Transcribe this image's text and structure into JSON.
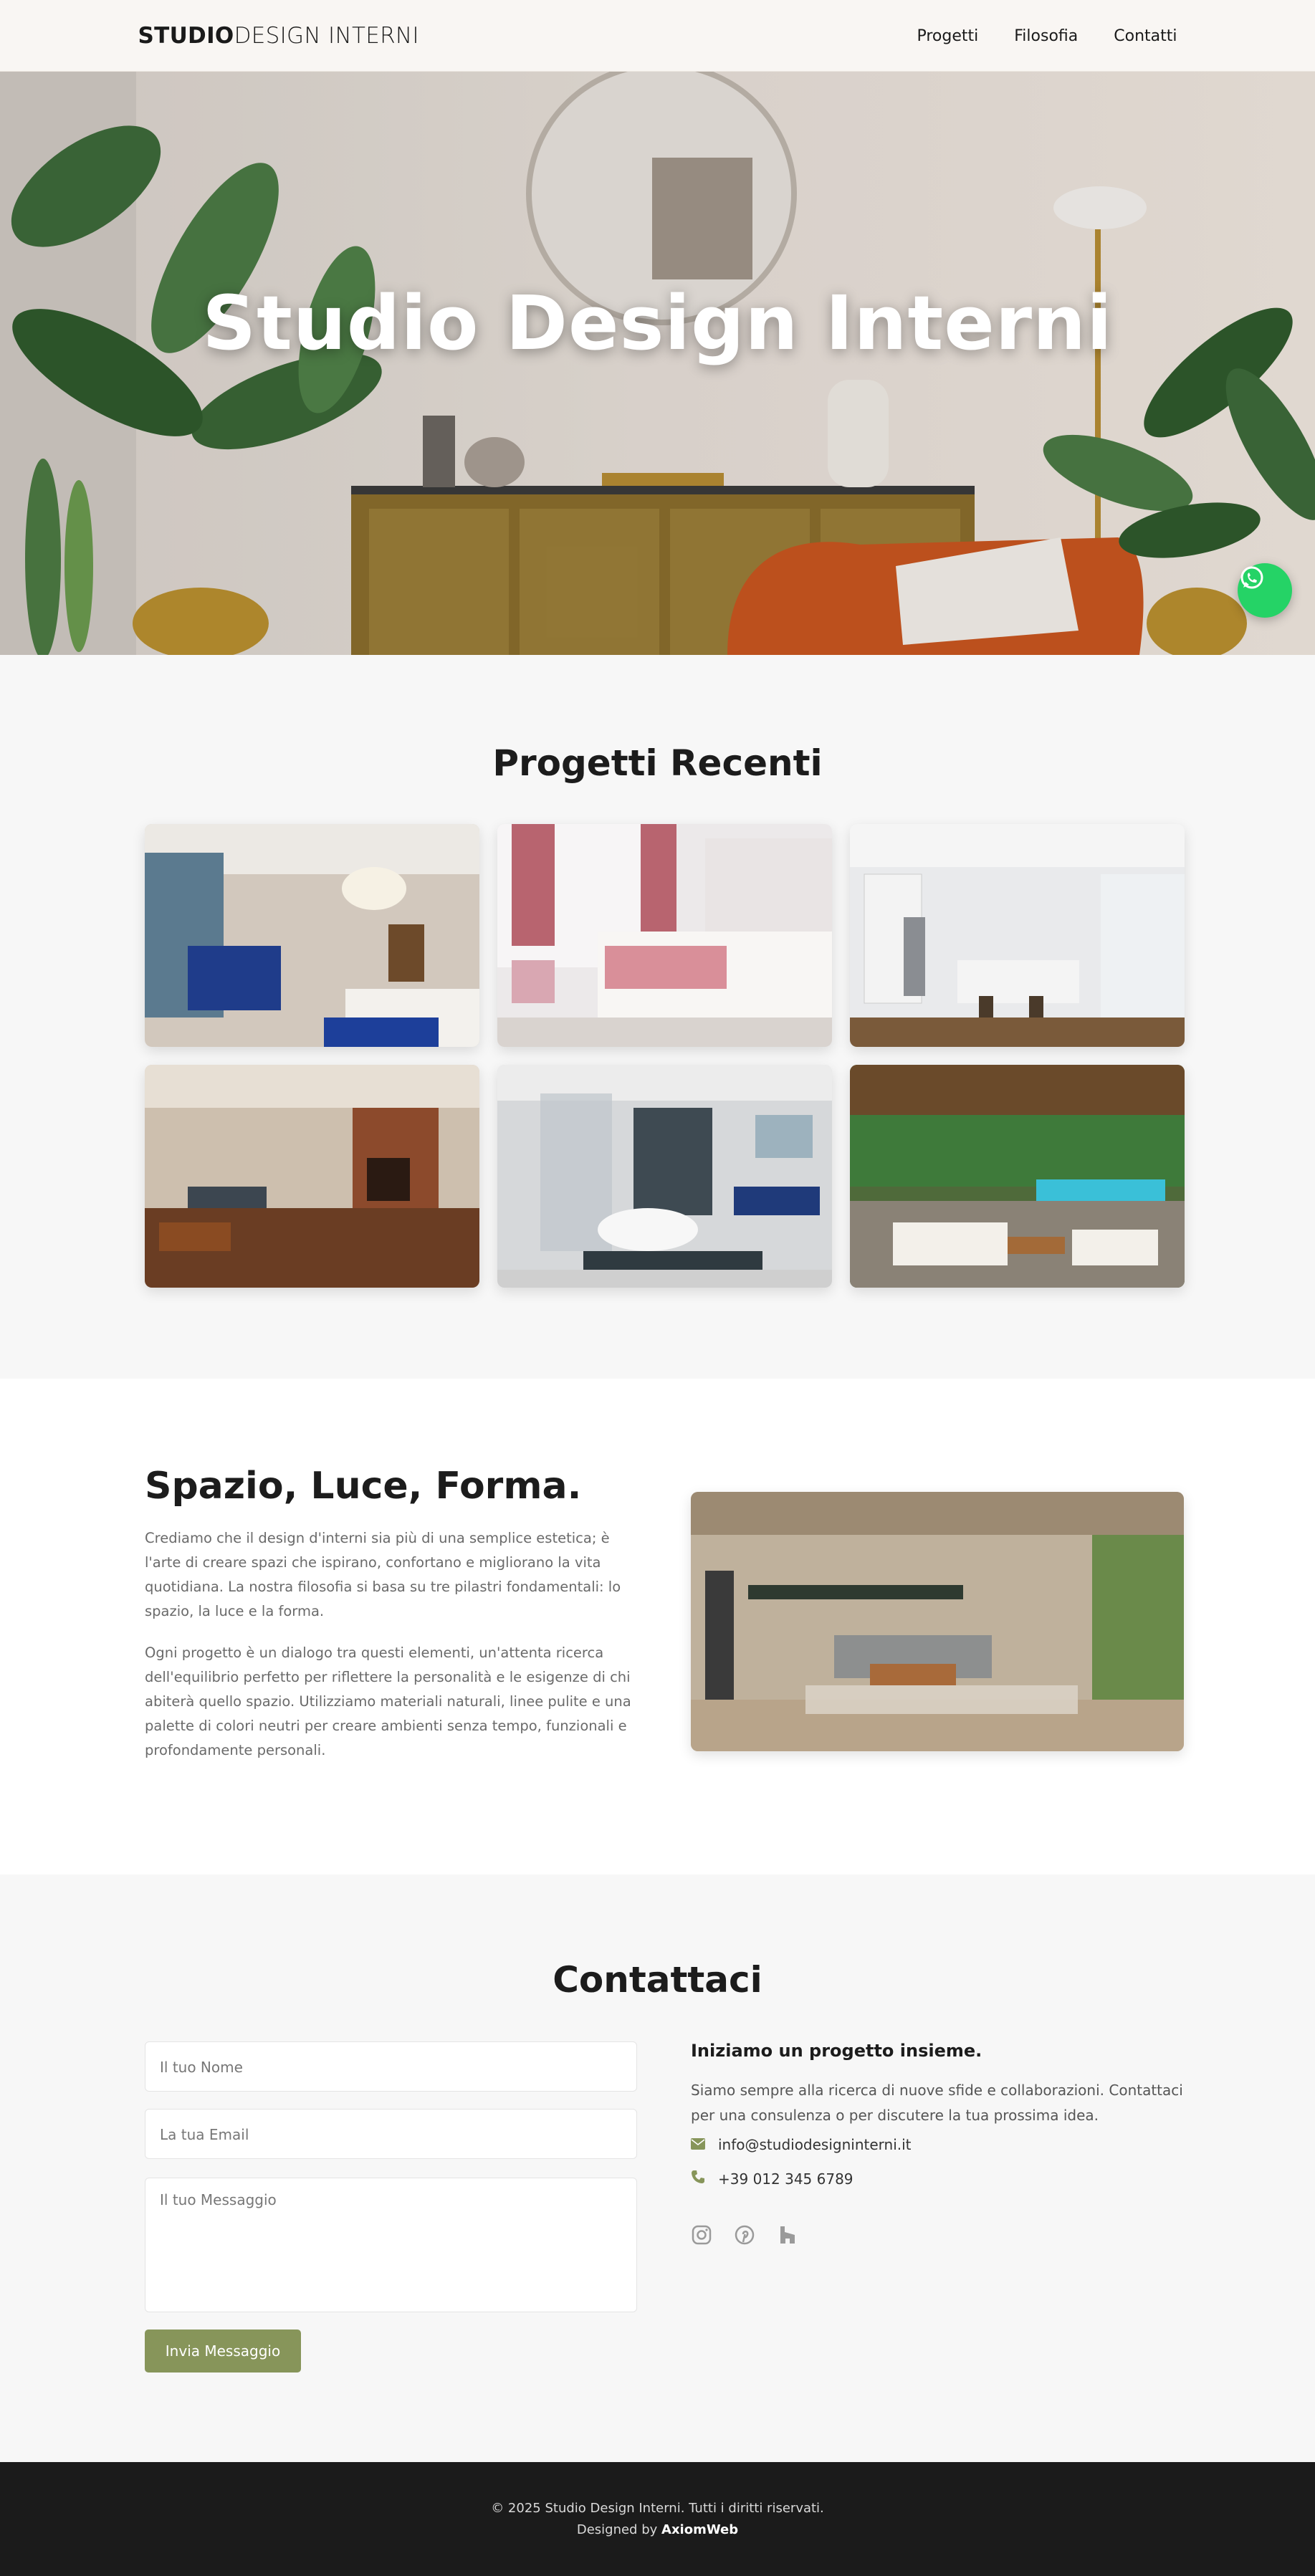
{
  "header": {
    "logo_bold": "STUDIO",
    "logo_light": "DESIGN INTERNI",
    "nav": [
      "Progetti",
      "Filosofia",
      "Contatti"
    ]
  },
  "hero": {
    "title": "Studio Design Interni"
  },
  "projects": {
    "title": "Progetti Recenti",
    "images": [
      "living-room-blue-armchair",
      "pink-bedroom",
      "white-kitchen-island",
      "basement-fireplace",
      "modern-bathroom-tub",
      "outdoor-patio-pool"
    ]
  },
  "philosophy": {
    "title": "Spazio, Luce, Forma.",
    "paragraphs": [
      "Crediamo che il design d'interni sia più di una semplice estetica; è l'arte di creare spazi che ispirano, confortano e migliorano la vita quotidiana. La nostra filosofia si basa su tre pilastri fondamentali: lo spazio, la luce e la forma.",
      "Ogni progetto è un dialogo tra questi elementi, un'attenta ricerca dell'equilibrio perfetto per riflettere la personalità e le esigenze di chi abiterà quello spazio. Utilizziamo materiali naturali, linee pulite e una palette di colori neutri per creare ambienti senza tempo, funzionali e profondamente personali."
    ]
  },
  "contact": {
    "title": "Contattaci",
    "form": {
      "name_placeholder": "Il tuo Nome",
      "email_placeholder": "La tua Email",
      "message_placeholder": "Il tuo Messaggio",
      "submit_label": "Invia Messaggio"
    },
    "info": {
      "title": "Iniziamo un progetto insieme.",
      "text": "Siamo sempre alla ricerca di nuove sfide e collaborazioni. Contattaci per una consulenza o per discutere la tua prossima idea.",
      "email": "info@studiodesigninterni.it",
      "phone": "+39 012 345 6789"
    },
    "socials": [
      "instagram-icon",
      "pinterest-icon",
      "houzz-icon"
    ]
  },
  "footer": {
    "copyright": "© 2025 Studio Design Interni. Tutti i diritti riservati.",
    "designed_by_prefix": "Designed by",
    "designed_by_name": "AxiomWeb"
  },
  "colors": {
    "accent": "#87955a",
    "whatsapp": "#25d366",
    "footer_bg": "#1b1b1b"
  }
}
